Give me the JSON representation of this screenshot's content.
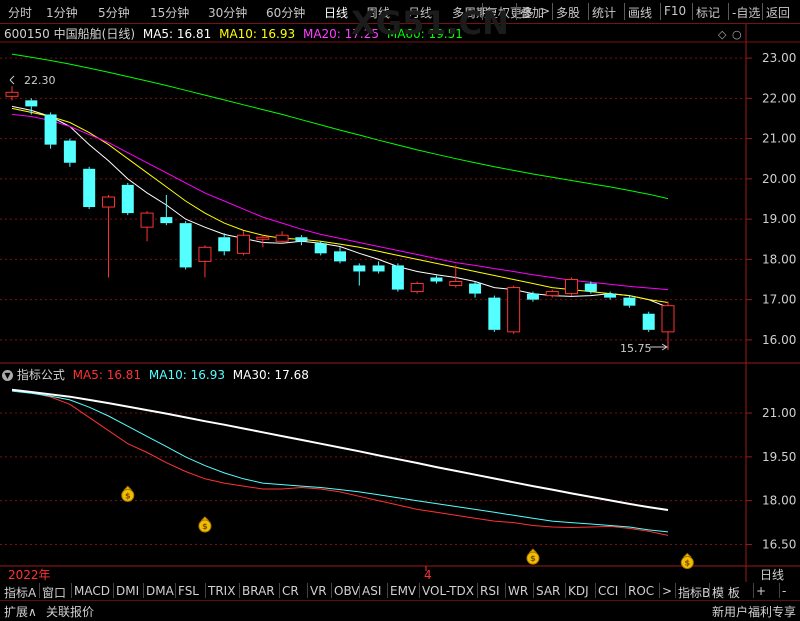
{
  "toolbar": {
    "periods": [
      "分时",
      "1分钟",
      "5分钟",
      "15分钟",
      "30分钟",
      "60分钟",
      "日线",
      "周线",
      "月线",
      "多周期",
      "更多"
    ],
    "more_arrow": ">",
    "actions": [
      "复权",
      "叠加",
      "多股",
      "统计",
      "画线",
      "F10",
      "标记",
      "-自选",
      "返回"
    ]
  },
  "stock": {
    "code": "600150",
    "name": "中国船舶(日线)"
  },
  "price_ma": {
    "ma5": "MA5: 16.81",
    "ma10": "MA10: 16.93",
    "ma20": "MA20: 17.25",
    "ma60": "MA60: 19.51"
  },
  "indicator": {
    "name": "指标公式",
    "ma5": "MA5: 16.81",
    "ma10": "MA10: 16.93",
    "ma30": "MA30: 17.68"
  },
  "annotations": {
    "high": "22.30",
    "low": "15.75"
  },
  "watermark": "XG51.CN",
  "timeline": {
    "year": "2022年",
    "month": "4",
    "period_label": "日线"
  },
  "bottom_tabs": [
    "指标A",
    "窗口",
    "MACD",
    "DMI",
    "DMA",
    "FSL",
    "TRIX",
    "BRAR",
    "CR",
    "VR",
    "OBV",
    "ASI",
    "EMV",
    "VOL-TDX",
    "RSI",
    "WR",
    "SAR",
    "KDJ",
    "CCI",
    "ROC",
    ">",
    "指标B",
    "模 板",
    "+",
    "-"
  ],
  "status": {
    "expand": "扩展∧",
    "related": "关联报价",
    "promo": "新用户福利专享"
  },
  "colors": {
    "up": "#ff3232",
    "down": "#54ffff",
    "ma5": "#ffffff",
    "ma10": "#ffff00",
    "ma20": "#ff00ff",
    "ma60": "#00ff00",
    "grid": "#7a1010"
  },
  "chart_data": [
    {
      "type": "candlestick",
      "title": "600150 中国船舶(日线)",
      "ylim": [
        15.6,
        23.3
      ],
      "yticks": [
        "16.00",
        "17.00",
        "18.00",
        "19.00",
        "20.00",
        "21.00",
        "22.00",
        "23.00"
      ],
      "candles": [
        {
          "o": 22.05,
          "c": 22.15,
          "h": 22.3,
          "l": 21.95
        },
        {
          "o": 21.95,
          "c": 21.8,
          "h": 22.0,
          "l": 21.6
        },
        {
          "o": 21.6,
          "c": 20.85,
          "h": 21.65,
          "l": 20.75
        },
        {
          "o": 20.95,
          "c": 20.4,
          "h": 21.0,
          "l": 20.3
        },
        {
          "o": 20.25,
          "c": 19.3,
          "h": 20.3,
          "l": 19.25
        },
        {
          "o": 19.3,
          "c": 19.55,
          "h": 19.6,
          "l": 17.55
        },
        {
          "o": 19.85,
          "c": 19.15,
          "h": 19.9,
          "l": 19.1
        },
        {
          "o": 18.8,
          "c": 19.15,
          "h": 19.2,
          "l": 18.45
        },
        {
          "o": 19.05,
          "c": 18.9,
          "h": 19.6,
          "l": 18.85
        },
        {
          "o": 18.9,
          "c": 17.8,
          "h": 18.95,
          "l": 17.75
        },
        {
          "o": 17.95,
          "c": 18.3,
          "h": 18.35,
          "l": 17.55
        },
        {
          "o": 18.55,
          "c": 18.2,
          "h": 18.65,
          "l": 18.1
        },
        {
          "o": 18.15,
          "c": 18.6,
          "h": 18.7,
          "l": 18.1
        },
        {
          "o": 18.5,
          "c": 18.55,
          "h": 18.6,
          "l": 18.3
        },
        {
          "o": 18.45,
          "c": 18.6,
          "h": 18.7,
          "l": 18.4
        },
        {
          "o": 18.55,
          "c": 18.45,
          "h": 18.6,
          "l": 18.35
        },
        {
          "o": 18.4,
          "c": 18.15,
          "h": 18.45,
          "l": 18.1
        },
        {
          "o": 18.2,
          "c": 17.95,
          "h": 18.3,
          "l": 17.9
        },
        {
          "o": 17.85,
          "c": 17.7,
          "h": 17.9,
          "l": 17.35
        },
        {
          "o": 17.85,
          "c": 17.7,
          "h": 17.95,
          "l": 17.65
        },
        {
          "o": 17.85,
          "c": 17.25,
          "h": 17.9,
          "l": 17.2
        },
        {
          "o": 17.2,
          "c": 17.4,
          "h": 17.45,
          "l": 17.15
        },
        {
          "o": 17.55,
          "c": 17.45,
          "h": 17.6,
          "l": 17.4
        },
        {
          "o": 17.35,
          "c": 17.45,
          "h": 17.85,
          "l": 17.3
        },
        {
          "o": 17.4,
          "c": 17.15,
          "h": 17.45,
          "l": 17.05
        },
        {
          "o": 17.05,
          "c": 16.25,
          "h": 17.1,
          "l": 16.2
        },
        {
          "o": 16.2,
          "c": 17.3,
          "h": 17.35,
          "l": 16.15
        },
        {
          "o": 17.15,
          "c": 17.0,
          "h": 17.2,
          "l": 16.95
        },
        {
          "o": 17.1,
          "c": 17.2,
          "h": 17.25,
          "l": 17.05
        },
        {
          "o": 17.15,
          "c": 17.5,
          "h": 17.55,
          "l": 17.1
        },
        {
          "o": 17.4,
          "c": 17.2,
          "h": 17.45,
          "l": 17.15
        },
        {
          "o": 17.15,
          "c": 17.05,
          "h": 17.2,
          "l": 17.0
        },
        {
          "o": 17.05,
          "c": 16.85,
          "h": 17.1,
          "l": 16.8
        },
        {
          "o": 16.65,
          "c": 16.25,
          "h": 16.7,
          "l": 16.2
        },
        {
          "o": 16.2,
          "c": 16.85,
          "h": 16.95,
          "l": 15.75
        }
      ],
      "series": [
        {
          "name": "MA5",
          "values": [
            21.8,
            21.7,
            21.55,
            21.3,
            20.85,
            20.45,
            20.0,
            19.65,
            19.35,
            19.0,
            18.8,
            18.62,
            18.52,
            18.42,
            18.4,
            18.45,
            18.4,
            18.32,
            18.15,
            18.0,
            17.82,
            17.7,
            17.62,
            17.55,
            17.45,
            17.3,
            17.25,
            17.15,
            17.1,
            17.08,
            17.1,
            17.15,
            17.1,
            17.0,
            16.81
          ]
        },
        {
          "name": "MA10",
          "values": [
            21.75,
            21.65,
            21.55,
            21.4,
            21.15,
            20.85,
            20.5,
            20.15,
            19.8,
            19.45,
            19.15,
            18.9,
            18.72,
            18.6,
            18.52,
            18.5,
            18.45,
            18.38,
            18.3,
            18.2,
            18.1,
            18.0,
            17.9,
            17.8,
            17.7,
            17.6,
            17.5,
            17.4,
            17.3,
            17.25,
            17.2,
            17.15,
            17.1,
            17.0,
            16.93
          ]
        },
        {
          "name": "MA20",
          "values": [
            21.6,
            21.55,
            21.45,
            21.3,
            21.1,
            20.9,
            20.65,
            20.4,
            20.15,
            19.9,
            19.65,
            19.45,
            19.25,
            19.05,
            18.9,
            18.75,
            18.62,
            18.52,
            18.42,
            18.32,
            18.22,
            18.12,
            18.02,
            17.92,
            17.85,
            17.77,
            17.7,
            17.62,
            17.55,
            17.48,
            17.43,
            17.38,
            17.33,
            17.29,
            17.25
          ]
        },
        {
          "name": "MA60",
          "values": [
            23.1,
            23.02,
            22.94,
            22.85,
            22.75,
            22.65,
            22.54,
            22.43,
            22.32,
            22.2,
            22.08,
            21.96,
            21.84,
            21.72,
            21.6,
            21.47,
            21.34,
            21.21,
            21.09,
            20.96,
            20.84,
            20.72,
            20.61,
            20.5,
            20.4,
            20.3,
            20.21,
            20.12,
            20.04,
            19.96,
            19.88,
            19.8,
            19.71,
            19.62,
            19.51
          ]
        }
      ]
    },
    {
      "type": "line",
      "title": "指标公式",
      "ylim": [
        15.9,
        22.2
      ],
      "yticks": [
        "16.50",
        "18.00",
        "19.50",
        "21.00"
      ],
      "series": [
        {
          "name": "MA5",
          "values": [
            21.8,
            21.7,
            21.55,
            21.3,
            20.85,
            20.4,
            19.95,
            19.65,
            19.3,
            19.0,
            18.75,
            18.6,
            18.5,
            18.4,
            18.4,
            18.45,
            18.4,
            18.3,
            18.15,
            18.0,
            17.85,
            17.7,
            17.6,
            17.5,
            17.4,
            17.3,
            17.25,
            17.15,
            17.1,
            17.08,
            17.1,
            17.12,
            17.05,
            16.95,
            16.81
          ]
        },
        {
          "name": "MA10",
          "values": [
            21.75,
            21.68,
            21.58,
            21.45,
            21.2,
            20.9,
            20.55,
            20.2,
            19.85,
            19.5,
            19.2,
            18.95,
            18.75,
            18.6,
            18.55,
            18.5,
            18.45,
            18.38,
            18.3,
            18.2,
            18.1,
            18.0,
            17.9,
            17.8,
            17.7,
            17.6,
            17.5,
            17.4,
            17.3,
            17.25,
            17.2,
            17.15,
            17.1,
            17.0,
            16.93
          ]
        },
        {
          "name": "MA30",
          "values": [
            21.8,
            21.72,
            21.64,
            21.56,
            21.45,
            21.34,
            21.22,
            21.1,
            20.98,
            20.85,
            20.72,
            20.6,
            20.47,
            20.34,
            20.21,
            20.08,
            19.95,
            19.82,
            19.69,
            19.55,
            19.42,
            19.29,
            19.15,
            19.02,
            18.89,
            18.76,
            18.63,
            18.5,
            18.38,
            18.25,
            18.13,
            18.01,
            17.89,
            17.78,
            17.68
          ]
        }
      ],
      "markers": [
        {
          "index": 6,
          "value": 18.25
        },
        {
          "index": 10,
          "value": 17.2
        },
        {
          "index": 27,
          "value": 16.1
        },
        {
          "index": 35,
          "value": 15.95
        }
      ]
    }
  ]
}
